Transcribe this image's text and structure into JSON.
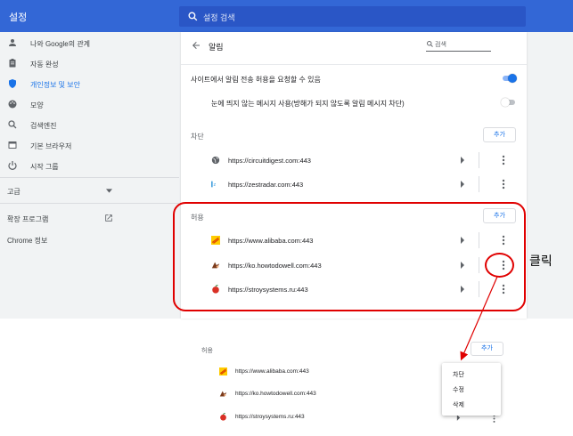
{
  "header": {
    "title": "설정",
    "search_placeholder": "설정 검색"
  },
  "sidebar": {
    "items": [
      {
        "label": "나와 Google의 관계",
        "icon": "person-icon"
      },
      {
        "label": "자동 완성",
        "icon": "clipboard-icon"
      },
      {
        "label": "개인정보 및 보안",
        "icon": "shield-icon",
        "active": true
      },
      {
        "label": "모양",
        "icon": "palette-icon"
      },
      {
        "label": "검색엔진",
        "icon": "search-icon"
      },
      {
        "label": "기본 브라우저",
        "icon": "browser-icon"
      },
      {
        "label": "시작 그룹",
        "icon": "power-icon"
      }
    ],
    "advanced_label": "고급",
    "extensions_label": "확장 프로그램",
    "about_label": "Chrome 정보"
  },
  "notifications": {
    "title": "알림",
    "search_placeholder": "검색",
    "ask_label": "사이트에서 알림 전송 허용을 요청할 수 있음",
    "ask_enabled": true,
    "quiet_label": "눈에 띄지 않는 메시지 사용(방해가 되지 않도록 알림 메시지 차단)",
    "quiet_enabled": false,
    "block": {
      "label": "차단",
      "add_label": "추가",
      "sites": [
        "https://circuitdigest.com:443",
        "https://zestradar.com:443"
      ]
    },
    "allow": {
      "label": "허용",
      "add_label": "추가",
      "sites": [
        "https://www.alibaba.com:443",
        "https://ko.howtodowell.com:443",
        "https://stroysystems.ru:443"
      ]
    }
  },
  "annotation": {
    "click_label": "클릭",
    "color": "#e00000"
  },
  "zoomed": {
    "label": "허용",
    "add_label": "추가",
    "sites": [
      "https://www.alibaba.com:443",
      "https://ko.howtodowell.com:443",
      "https://stroysystems.ru:443"
    ],
    "menu": [
      "차단",
      "수정",
      "삭제"
    ]
  },
  "colors": {
    "topbar": "#3367d6",
    "accent": "#1a73e8",
    "annotation": "#e00000"
  }
}
